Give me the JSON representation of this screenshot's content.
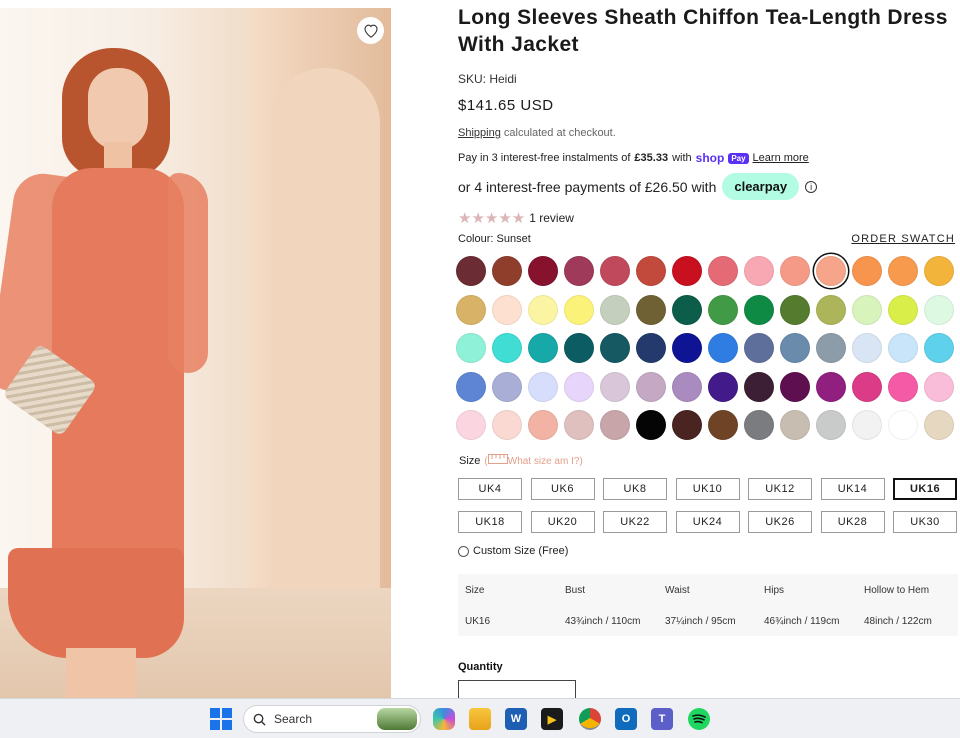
{
  "product": {
    "title": "Long Sleeves Sheath Chiffon Tea-Length Dress With Jacket",
    "sku": "SKU: Heidi",
    "price": "$141.65 USD",
    "shipping_link": "Shipping",
    "shipping_rest": " calculated at checkout.",
    "shoppay_text": "Pay in 3 interest-free instalments of",
    "shoppay_amount": "£35.33",
    "shoppay_with": "with",
    "shop_logo": "shop",
    "pay_chip": "Pay",
    "learn_more": "Learn more",
    "clearpay_text": "or 4 interest-free payments of £26.50 with",
    "clearpay_logo": "clearpay",
    "info_glyph": "i",
    "stars": "★★★★★",
    "rating_count": "1 review",
    "rating_value": 0,
    "colour_label": "Colour: Sunset",
    "order_swatch": "ORDER SWATCH",
    "heart_icon": "heart-icon"
  },
  "swatches": [
    "#6b2d33",
    "#8f3e2c",
    "#86122e",
    "#a03a5a",
    "#c04a5c",
    "#c24a3c",
    "#c8101e",
    "#e46a75",
    "#f7a8b2",
    "#f59a86",
    "#f6a58a",
    "#f7954f",
    "#f79a4e",
    "#f2b43a",
    "#d8b266",
    "#fde0cf",
    "#fbf5a3",
    "#fbf27a",
    "#c4d0bd",
    "#6f6134",
    "#0c5d4a",
    "#419a45",
    "#0f8a44",
    "#557b2e",
    "#adb55a",
    "#d9f3bc",
    "#d9ee48",
    "#ddf9e2",
    "#8ff1d8",
    "#3fddd3",
    "#17a9a8",
    "#0c5d63",
    "#175963",
    "#243a6d",
    "#0f1494",
    "#2f7de3",
    "#5e6f9b",
    "#6b8bac",
    "#8c9ca8",
    "#d9e5f5",
    "#c8e5f9",
    "#5ed1ec",
    "#5d85d4",
    "#a9aed6",
    "#d7defb",
    "#e8d5fb",
    "#d9c7d9",
    "#c4a8c4",
    "#a98bbf",
    "#431a89",
    "#3c1f34",
    "#5e0f4f",
    "#901f80",
    "#dc3b87",
    "#f45aa6",
    "#f9bcd9",
    "#fbd6e1",
    "#f9d9d2",
    "#f2b3a4",
    "#dfc0be",
    "#c7a5a8",
    "#050505",
    "#4a2420",
    "#6f4426",
    "#7a7c80",
    "#c7bdb0",
    "#c9cbcb",
    "#f2f2f2",
    "#ffffff",
    "#e6d7c0"
  ],
  "selected_swatch_index": 10,
  "size": {
    "label": "Size",
    "help": "What size am I?)",
    "help_prefix": "(",
    "options": [
      "UK4",
      "UK6",
      "UK8",
      "UK10",
      "UK12",
      "UK14",
      "UK16",
      "UK18",
      "UK20",
      "UK22",
      "UK24",
      "UK26",
      "UK28",
      "UK30"
    ],
    "selected": "UK16",
    "custom_label": "Custom Size (Free)"
  },
  "size_table": {
    "headers": [
      "Size",
      "Bust",
      "Waist",
      "Hips",
      "Hollow to Hem"
    ],
    "row": [
      "UK16",
      "43¾inch / 110cm",
      "37¼inch / 95cm",
      "46¾inch / 119cm",
      "48inch / 122cm"
    ]
  },
  "quantity": {
    "label": "Quantity"
  },
  "taskbar": {
    "search_placeholder": "Search",
    "icons": [
      "windows-start-icon",
      "search-icon",
      "copilot-icon",
      "file-explorer-icon",
      "word-icon",
      "media-player-icon",
      "chrome-icon",
      "outlook-icon",
      "teams-icon",
      "spotify-icon"
    ],
    "word_glyph": "W",
    "media_glyph": "▶",
    "outlook_glyph": "O",
    "teams_glyph": "T"
  }
}
